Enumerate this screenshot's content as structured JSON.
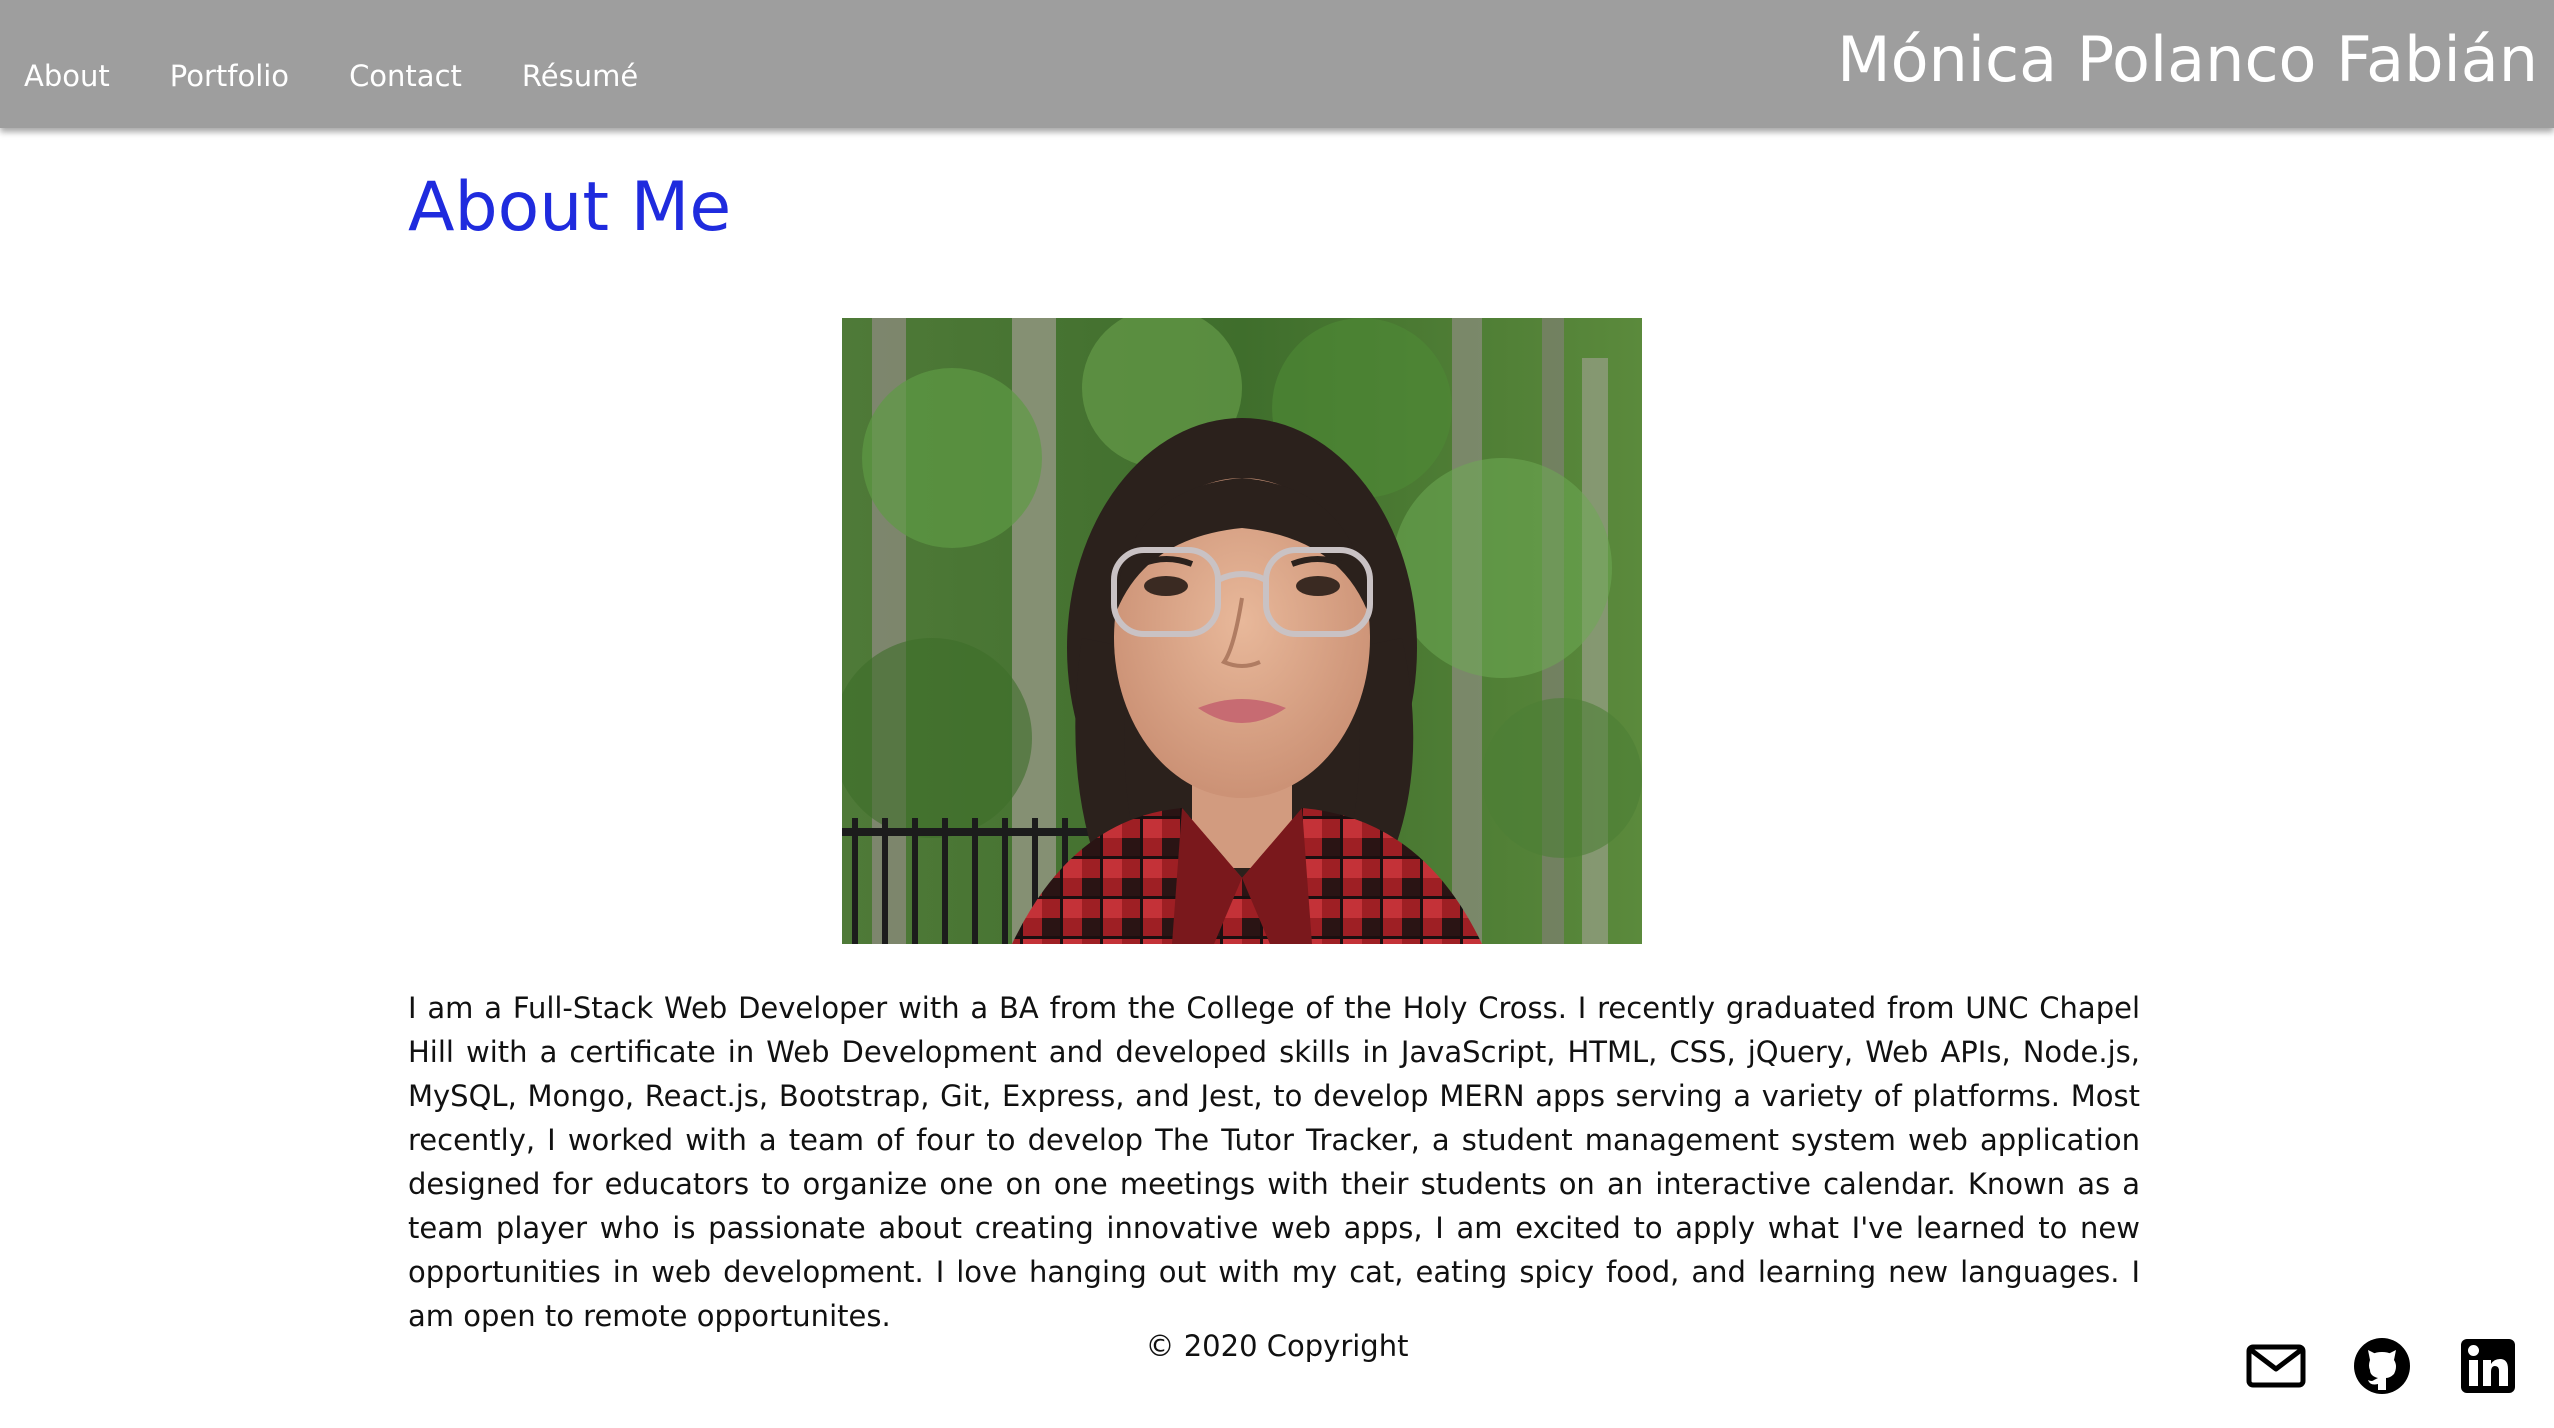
{
  "header": {
    "site_name": "Mónica Polanco Fabián",
    "nav": [
      {
        "label": "About"
      },
      {
        "label": "Portfolio"
      },
      {
        "label": "Contact"
      },
      {
        "label": "Résumé"
      }
    ],
    "background_color": "#9e9e9e"
  },
  "main": {
    "title": "About Me",
    "title_color": "#1f2bde",
    "bio": "I am a Full-Stack Web Developer with a BA from the College of the Holy Cross. I recently graduated from UNC Chapel Hill with a certificate in Web Development and developed skills in JavaScript, HTML, CSS, jQuery, Web APIs, Node.js, MySQL, Mongo, React.js, Bootstrap, Git, Express, and Jest, to develop MERN apps serving a variety of platforms. Most recently, I worked with a team of four to develop The Tutor Tracker, a student management system web application designed for educators to organize one on one meetings with their students on an interactive calendar. Known as a team player who is passionate about creating innovative web apps, I am excited to apply what I've learned to new opportunities in web development. I love hanging out with my cat, eating spicy food, and learning new languages. I am open to remote opportunites."
  },
  "footer": {
    "copyright": "© 2020 Copyright",
    "social_icons": [
      "envelope-icon",
      "github-icon",
      "linkedin-icon"
    ]
  }
}
